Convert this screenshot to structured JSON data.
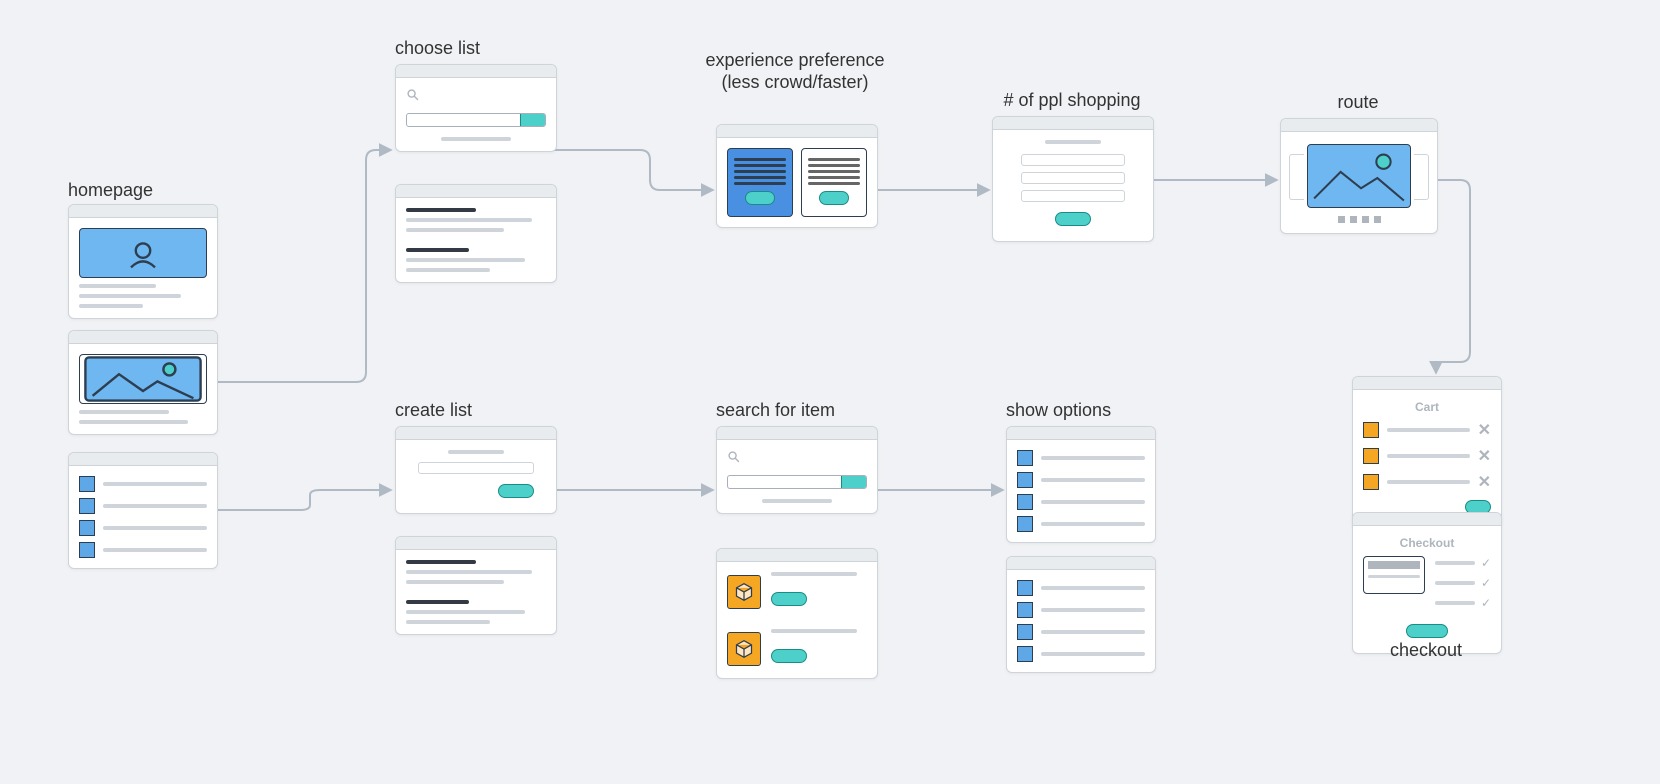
{
  "nodes": {
    "homepage": {
      "label": "homepage"
    },
    "choose_list": {
      "label": "choose list"
    },
    "experience_pref": {
      "label": "experience preference (less crowd/faster)"
    },
    "ppl_shopping": {
      "label": "# of ppl shopping"
    },
    "route": {
      "label": "route"
    },
    "create_list": {
      "label": "create list"
    },
    "search_item": {
      "label": "search for item"
    },
    "show_options": {
      "label": "show options"
    },
    "checkout": {
      "label": "checkout"
    }
  },
  "panels": {
    "cart_title": "Cart",
    "checkout_title": "Checkout"
  },
  "flow_edges": [
    [
      "homepage",
      "choose_list"
    ],
    [
      "choose_list",
      "experience_pref"
    ],
    [
      "experience_pref",
      "ppl_shopping"
    ],
    [
      "ppl_shopping",
      "route"
    ],
    [
      "homepage",
      "create_list"
    ],
    [
      "create_list",
      "search_item"
    ],
    [
      "search_item",
      "show_options"
    ],
    [
      "route",
      "checkout"
    ]
  ]
}
